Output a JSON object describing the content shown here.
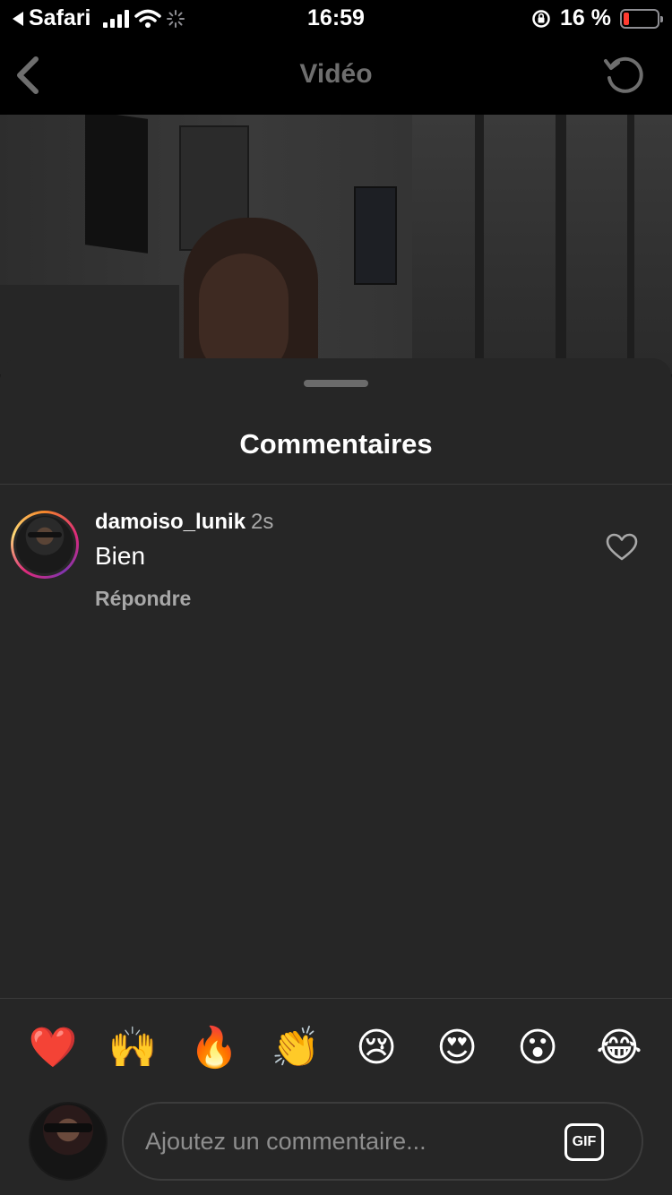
{
  "status_bar": {
    "back_app": "Safari",
    "time": "16:59",
    "battery_percent": "16 %",
    "battery_level": 0.16
  },
  "nav": {
    "title": "Vidéo",
    "back_icon": "chevron-left-icon",
    "refresh_icon": "refresh-icon"
  },
  "comments_sheet": {
    "title": "Commentaires",
    "comments": [
      {
        "username": "damoiso_lunik",
        "time": "2s",
        "text": "Bien",
        "reply_label": "Répondre"
      }
    ]
  },
  "quick_reactions": [
    "❤️",
    "🙌",
    "🔥",
    "👏",
    "😢",
    "😍",
    "😮",
    "😂"
  ],
  "composer": {
    "placeholder": "Ajoutez un commentaire...",
    "gif_label": "GIF"
  },
  "colors": {
    "sheet_bg": "#262626",
    "secondary_text": "#a8a8a8",
    "battery_low": "#ff3b30"
  }
}
